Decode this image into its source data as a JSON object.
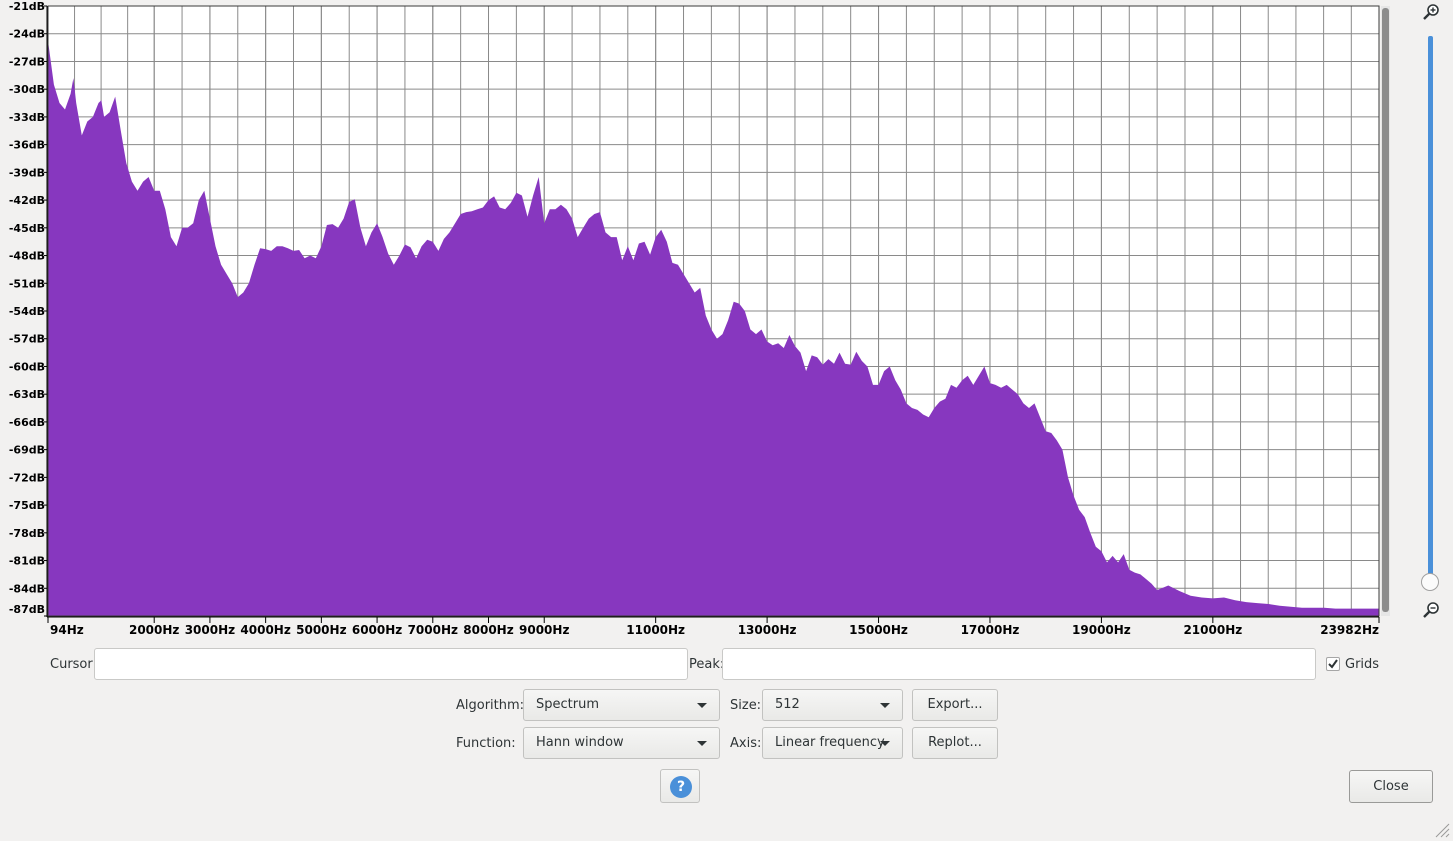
{
  "chart_data": {
    "type": "area",
    "y_unit": "dB",
    "x_unit": "Hz",
    "ylim": [
      -87,
      -21
    ],
    "xlim": [
      94,
      23982
    ],
    "grid": true,
    "y_ticks": [
      "-21dB",
      "-24dB",
      "-27dB",
      "-30dB",
      "-33dB",
      "-36dB",
      "-39dB",
      "-42dB",
      "-45dB",
      "-48dB",
      "-51dB",
      "-54dB",
      "-57dB",
      "-60dB",
      "-63dB",
      "-66dB",
      "-69dB",
      "-72dB",
      "-75dB",
      "-78dB",
      "-81dB",
      "-84dB",
      "-87dB"
    ],
    "x_tick_values": [
      94,
      2000,
      3000,
      4000,
      5000,
      6000,
      7000,
      8000,
      9000,
      11000,
      13000,
      15000,
      17000,
      19000,
      21000,
      23982
    ],
    "x_tick_labels": [
      "94Hz",
      "2000Hz",
      "3000Hz",
      "4000Hz",
      "5000Hz",
      "6000Hz",
      "7000Hz",
      "8000Hz",
      "9000Hz",
      "11000Hz",
      "13000Hz",
      "15000Hz",
      "17000Hz",
      "19000Hz",
      "21000Hz",
      "23982Hz"
    ],
    "color": "#8737bf",
    "x": [
      0,
      100,
      200,
      300,
      400,
      500,
      550,
      600,
      700,
      800,
      900,
      1000,
      1050,
      1100,
      1200,
      1300,
      1400,
      1500,
      1600,
      1700,
      1800,
      1900,
      2000,
      2100,
      2200,
      2300,
      2400,
      2500,
      2600,
      2700,
      2800,
      2900,
      3000,
      3100,
      3200,
      3300,
      3400,
      3500,
      3600,
      3700,
      3800,
      3900,
      4000,
      4100,
      4200,
      4300,
      4400,
      4500,
      4600,
      4700,
      4800,
      4900,
      5000,
      5100,
      5200,
      5300,
      5400,
      5500,
      5600,
      5700,
      5800,
      5900,
      6000,
      6100,
      6200,
      6300,
      6400,
      6500,
      6600,
      6700,
      6800,
      6900,
      7000,
      7100,
      7200,
      7300,
      7400,
      7500,
      7600,
      7700,
      7800,
      7900,
      8000,
      8100,
      8200,
      8300,
      8400,
      8500,
      8600,
      8700,
      8800,
      8900,
      9000,
      9100,
      9200,
      9300,
      9400,
      9500,
      9600,
      9700,
      9800,
      9900,
      10000,
      10100,
      10200,
      10300,
      10400,
      10500,
      10600,
      10700,
      10800,
      10900,
      11000,
      11100,
      11200,
      11300,
      11400,
      11500,
      11600,
      11700,
      11800,
      11900,
      12000,
      12100,
      12200,
      12300,
      12400,
      12500,
      12600,
      12700,
      12800,
      12900,
      13000,
      13100,
      13200,
      13300,
      13400,
      13500,
      13600,
      13700,
      13800,
      13900,
      14000,
      14100,
      14200,
      14300,
      14400,
      14500,
      14600,
      14700,
      14800,
      14900,
      15000,
      15100,
      15200,
      15300,
      15400,
      15500,
      15600,
      15700,
      15800,
      15900,
      16000,
      16100,
      16200,
      16300,
      16400,
      16500,
      16600,
      16700,
      16800,
      16900,
      17000,
      17100,
      17200,
      17300,
      17400,
      17500,
      17600,
      17700,
      17800,
      17900,
      18000,
      18100,
      18200,
      18300,
      18400,
      18500,
      18600,
      18700,
      18800,
      18900,
      19000,
      19100,
      19200,
      19300,
      19400,
      19500,
      19600,
      19700,
      19800,
      19900,
      20000,
      20200,
      20400,
      20600,
      20800,
      21000,
      21200,
      21400,
      21600,
      21800,
      22000,
      22200,
      22400,
      22600,
      22800,
      23000,
      23200,
      23400,
      23600,
      23800,
      23982
    ],
    "y": [
      -21,
      -25,
      -29.5,
      -31.5,
      -32.2,
      -30.5,
      -28.8,
      -31.5,
      -35,
      -33.5,
      -33,
      -31.5,
      -31.2,
      -33,
      -32.5,
      -30.8,
      -34.5,
      -38,
      -40,
      -41,
      -40,
      -39.5,
      -41,
      -41,
      -43,
      -46,
      -47,
      -45,
      -45,
      -44.5,
      -42,
      -41,
      -44,
      -47,
      -49,
      -50,
      -51,
      -52.5,
      -52,
      -51,
      -49,
      -47.2,
      -47.3,
      -47.5,
      -47,
      -47,
      -47.2,
      -47.5,
      -47.4,
      -48.3,
      -48,
      -48.3,
      -47,
      -44.7,
      -44.6,
      -45,
      -44,
      -42.2,
      -41.9,
      -45,
      -47,
      -45.5,
      -44.5,
      -46,
      -47.8,
      -49,
      -48,
      -46.8,
      -47.1,
      -48.3,
      -47,
      -46.3,
      -46.5,
      -47.5,
      -46.2,
      -45.5,
      -44.5,
      -43.5,
      -43.3,
      -43.2,
      -43,
      -42.8,
      -42,
      -41.6,
      -42.8,
      -43,
      -42.3,
      -41.2,
      -41.5,
      -43.8,
      -41.5,
      -39.5,
      -44.5,
      -43,
      -43,
      -42.5,
      -43,
      -44,
      -46,
      -45,
      -44,
      -43.5,
      -43.3,
      -45.5,
      -46,
      -46,
      -48.5,
      -47,
      -48.5,
      -46.7,
      -46.5,
      -47.9,
      -46,
      -45.2,
      -46.5,
      -48.8,
      -49,
      -50,
      -51,
      -52,
      -51.5,
      -54.5,
      -56,
      -57,
      -56.5,
      -55,
      -53,
      -53.2,
      -54,
      -56,
      -56.5,
      -56,
      -57.3,
      -57.7,
      -57.5,
      -58,
      -56.6,
      -57.8,
      -58.5,
      -60.5,
      -58.8,
      -59,
      -59.8,
      -59.2,
      -59.7,
      -58.5,
      -59.7,
      -59.8,
      -58.4,
      -59.4,
      -60,
      -62,
      -62,
      -60.5,
      -60,
      -61.5,
      -62.5,
      -64,
      -64.5,
      -64.7,
      -65.2,
      -65.5,
      -64.5,
      -63.8,
      -63.5,
      -62,
      -62.3,
      -61.5,
      -61,
      -62,
      -61,
      -60,
      -61.8,
      -62,
      -62.3,
      -62,
      -62.5,
      -63,
      -64,
      -64.5,
      -64,
      -65.5,
      -67,
      -67.2,
      -68,
      -69,
      -72,
      -74,
      -75.5,
      -76.3,
      -78,
      -79.5,
      -80,
      -81.2,
      -80.5,
      -81.2,
      -80.3,
      -82,
      -82.3,
      -82.5,
      -83,
      -83.5,
      -84.2,
      -83.7,
      -84.3,
      -84.8,
      -85,
      -85.1,
      -85,
      -85.3,
      -85.5,
      -85.6,
      -85.7,
      -85.9,
      -86,
      -86.1,
      -86.1,
      -86.1,
      -86.2,
      -86.2,
      -86.2,
      -86.2,
      -86.2,
      -86.2,
      -86.3,
      -86.5,
      -86.8,
      -87.2,
      -87.4,
      -87.6,
      -87.5
    ]
  },
  "cursor": {
    "label": "Cursor:",
    "value": ""
  },
  "peak": {
    "label": "Peak:",
    "value": ""
  },
  "grids": {
    "label": "Grids",
    "checked": true
  },
  "algorithm": {
    "label": "Algorithm:",
    "value": "Spectrum"
  },
  "size": {
    "label": "Size:",
    "value": "512"
  },
  "function": {
    "label": "Function:",
    "value": "Hann window"
  },
  "axis": {
    "label": "Axis:",
    "value": "Linear frequency"
  },
  "buttons": {
    "export": "Export...",
    "replot": "Replot...",
    "close": "Close",
    "help": "?"
  }
}
